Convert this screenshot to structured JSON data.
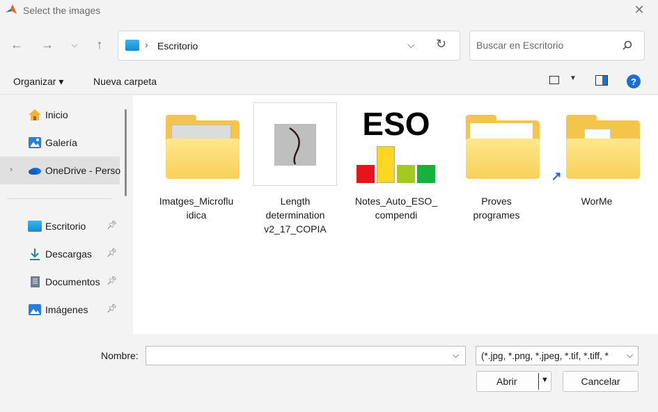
{
  "window": {
    "title": "Select the images",
    "app_icon": "matlab-icon"
  },
  "nav": {
    "back_icon": "arrow-left-icon",
    "forward_icon": "arrow-right-icon",
    "recent_icon": "chevron-down-icon",
    "up_icon": "arrow-up-icon",
    "address": {
      "crumb": "Escritorio",
      "separator": "›"
    },
    "search_placeholder": "Buscar en Escritorio"
  },
  "commands": {
    "organize": "Organizar",
    "new_folder": "Nueva carpeta"
  },
  "sidebar": {
    "items": [
      {
        "label": "Inicio",
        "icon": "home-icon",
        "pinned": false
      },
      {
        "label": "Galería",
        "icon": "gallery-icon",
        "pinned": false
      },
      {
        "label": "OneDrive - Perso",
        "icon": "cloud-icon",
        "pinned": false,
        "selected": true
      },
      {
        "label": "Escritorio",
        "icon": "desktop-icon",
        "pinned": true
      },
      {
        "label": "Descargas",
        "icon": "download-icon",
        "pinned": true
      },
      {
        "label": "Documentos",
        "icon": "document-icon",
        "pinned": true
      },
      {
        "label": "Imágenes",
        "icon": "image-icon",
        "pinned": true
      }
    ]
  },
  "files": [
    {
      "name": "Imatges_Microfluidica",
      "line1": "Imatges_Microflu",
      "line2": "idica",
      "line3": "",
      "type": "folder"
    },
    {
      "name": "Length determination v2_17_COPIA",
      "line1": "Length",
      "line2": "determination",
      "line3": "v2_17_COPIA",
      "type": "image"
    },
    {
      "name": "Notes_Auto_ESO_compendi",
      "line1": "Notes_Auto_ESO_",
      "line2": "compendi",
      "line3": "",
      "type": "image",
      "logo_text": "ESO"
    },
    {
      "name": "Proves programes",
      "line1": "Proves",
      "line2": "programes",
      "line3": "",
      "type": "folder"
    },
    {
      "name": "WorMe",
      "line1": "WorMe",
      "line2": "",
      "line3": "",
      "type": "shortcut-folder"
    }
  ],
  "footer": {
    "name_label": "Nombre:",
    "name_value": "",
    "filter": "(*.jpg, *.png, *.jpeg, *.tif, *.tiff, *",
    "open": "Abrir",
    "cancel": "Cancelar"
  },
  "colors": {
    "accent": "#1f6fd1",
    "folder": "#f3c64b"
  }
}
